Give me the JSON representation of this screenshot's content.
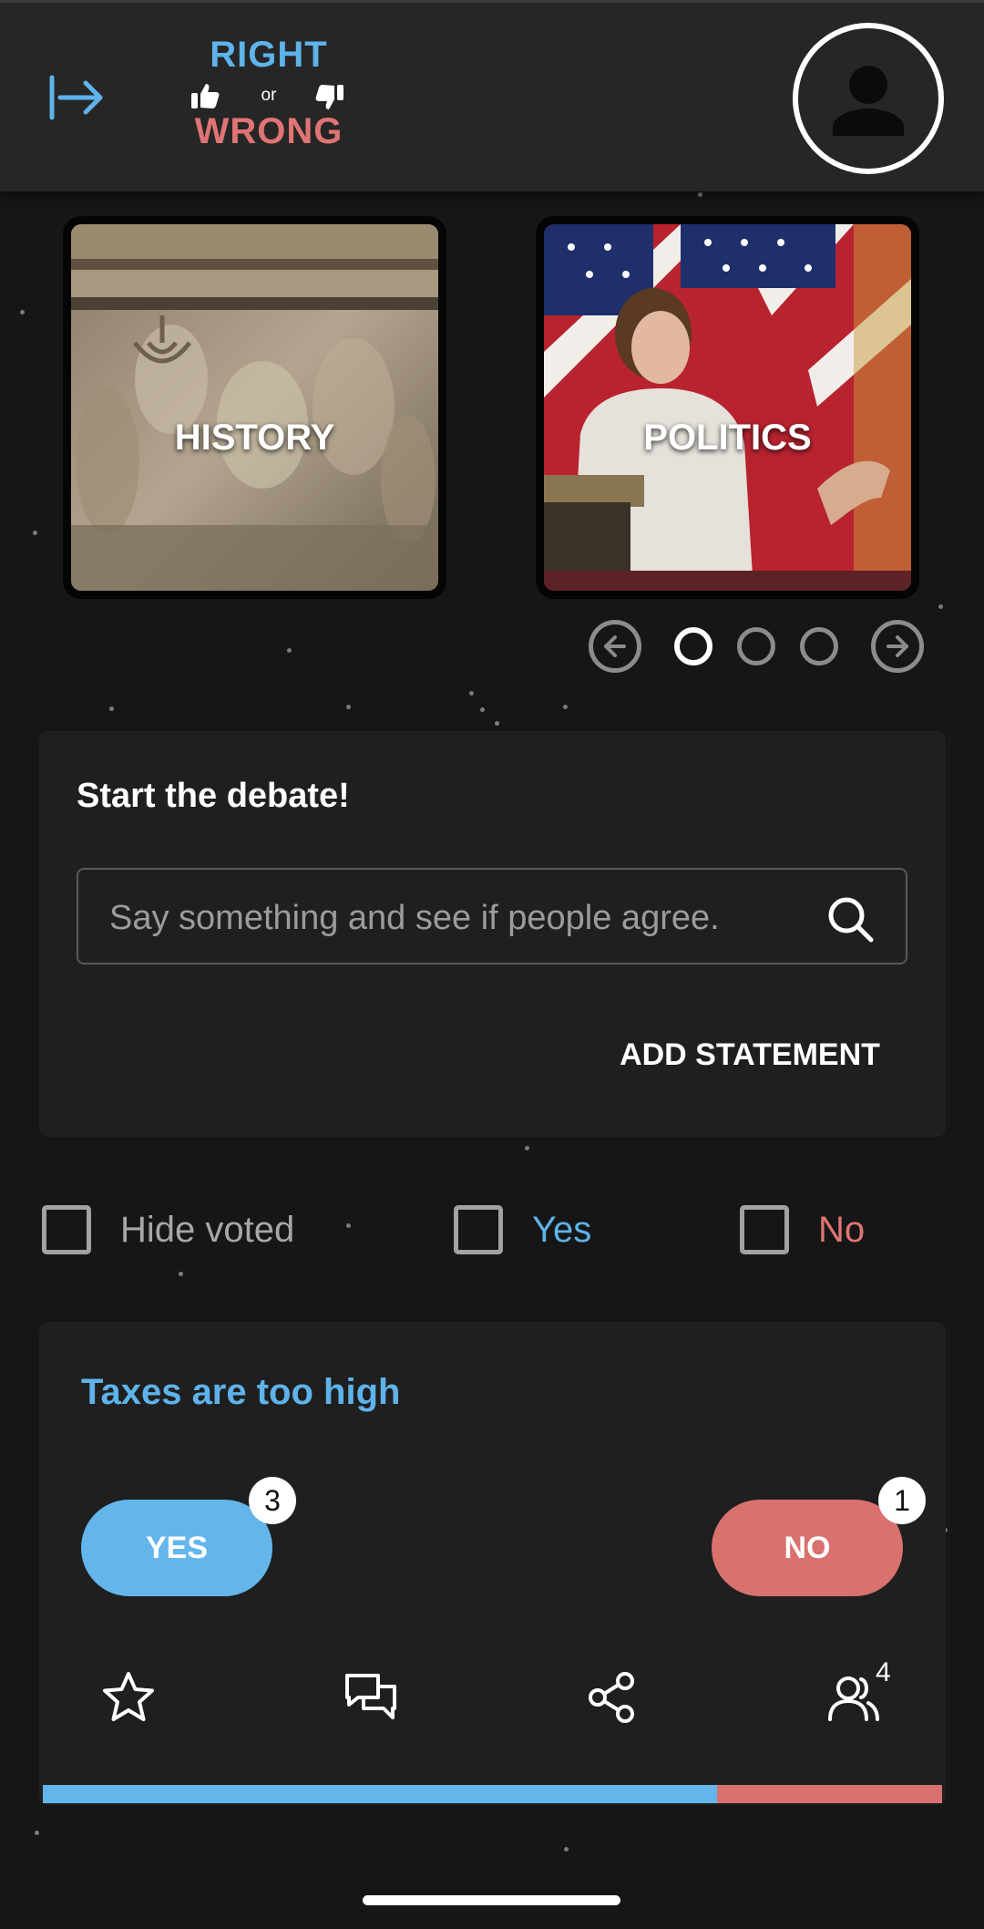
{
  "header": {
    "logo_top": "RIGHT",
    "logo_middle": "or",
    "logo_bottom": "WRONG",
    "icons": {
      "menu": "collapse-arrow-icon",
      "thumb_up": "thumbs-up-icon",
      "thumb_down": "thumbs-down-icon",
      "profile": "profile-avatar-icon"
    }
  },
  "categories": [
    {
      "label": "HISTORY"
    },
    {
      "label": "POLITICS"
    }
  ],
  "carousel": {
    "pages": 3,
    "active_page": 1,
    "icons": {
      "prev": "arrow-left-circle-icon",
      "next": "arrow-right-circle-icon"
    }
  },
  "debate": {
    "title": "Start the debate!",
    "placeholder": "Say something and see if people agree.",
    "add_label": "ADD STATEMENT"
  },
  "filters": {
    "hide_voted": "Hide voted",
    "yes": "Yes",
    "no": "No"
  },
  "statement": {
    "title": "Taxes are too high",
    "yes_label": "YES",
    "no_label": "NO",
    "yes_count": "3",
    "no_count": "1",
    "participants": "4",
    "yes_fraction": 0.75,
    "icons": [
      "star-icon",
      "comments-icon",
      "share-icon",
      "people-icon"
    ]
  },
  "colors": {
    "yes": "#63b6ec",
    "no": "#d9716f",
    "background": "#161616",
    "card": "#1f1f1f",
    "header": "#262626"
  }
}
